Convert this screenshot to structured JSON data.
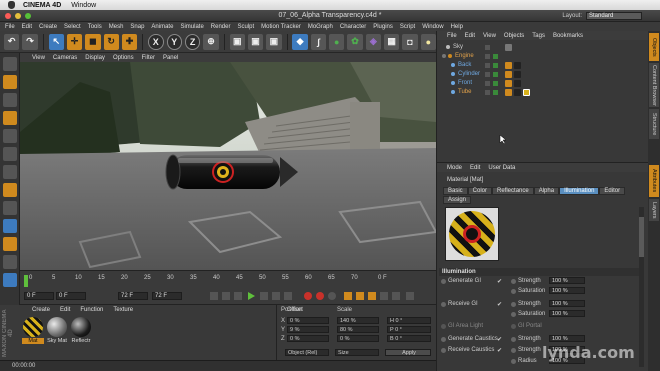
{
  "os_menu": {
    "app_name": "CINEMA 4D",
    "items": [
      "Window"
    ]
  },
  "window": {
    "title": "07_06_Alpha Transparency.c4d *",
    "layout_label": "Layout:",
    "layout_value": "Standard"
  },
  "main_menu": [
    "File",
    "Edit",
    "Create",
    "Select",
    "Tools",
    "Mesh",
    "Snap",
    "Animate",
    "Simulate",
    "Render",
    "Sculpt",
    "Motion Tracker",
    "MoGraph",
    "Character",
    "Plugins",
    "Script",
    "Window",
    "Help"
  ],
  "toolbar": {
    "axis_x": "X",
    "axis_y": "Y",
    "axis_z": "Z"
  },
  "viewport_menu": [
    "View",
    "Cameras",
    "Display",
    "Options",
    "Filter",
    "Panel"
  ],
  "timeline": {
    "ticks": [
      "0",
      "5",
      "10",
      "15",
      "20",
      "25",
      "30",
      "35",
      "40",
      "45",
      "50",
      "55",
      "60",
      "65",
      "70",
      "0 F"
    ],
    "start_field": "0 F",
    "current_field": "0 F",
    "end_field": "72 F",
    "max_field": "72 F"
  },
  "material_manager": {
    "menu": [
      "Create",
      "Edit",
      "Function",
      "Texture"
    ],
    "materials": [
      {
        "name": "Mat",
        "selected": true
      },
      {
        "name": "Sky Mat",
        "selected": false
      },
      {
        "name": "Reflectr",
        "selected": false
      }
    ]
  },
  "coordinates": {
    "headers": {
      "position": "Position",
      "offset": "Offset",
      "scale": "Scale"
    },
    "rows": [
      {
        "axis": "X",
        "pos": "0 %",
        "scale": "140 %",
        "extra": "H  0 °"
      },
      {
        "axis": "Y",
        "pos": "9 %",
        "scale": "80 %",
        "extra": "P  0 °"
      },
      {
        "axis": "Z",
        "pos": "0 %",
        "scale": "0 %",
        "extra": "B  0 °"
      }
    ],
    "mode_select": "Object (Rel)",
    "size_select": "Size",
    "apply_label": "Apply"
  },
  "status_text": "00:00:00",
  "maxon_text": "MAXON CINEMA 4D",
  "object_manager": {
    "menu": [
      "File",
      "Edit",
      "View",
      "Objects",
      "Tags",
      "Bookmarks"
    ],
    "objects": [
      {
        "name": "Sky",
        "indent": 0,
        "color": "#bbbbbb"
      },
      {
        "name": "Engine",
        "indent": 0,
        "color": "#d08a1e"
      },
      {
        "name": "Back",
        "indent": 1,
        "color": "#6fa8e0"
      },
      {
        "name": "Cylinder",
        "indent": 1,
        "color": "#6fa8e0"
      },
      {
        "name": "Front",
        "indent": 1,
        "color": "#6fa8e0"
      },
      {
        "name": "Tube",
        "indent": 1,
        "color": "#d08a1e"
      }
    ]
  },
  "attribute_manager": {
    "menu": [
      "Mode",
      "Edit",
      "User Data"
    ],
    "header": "Material [Mat]",
    "tabs": [
      "Basic",
      "Color",
      "Reflectance",
      "Alpha",
      "Illumination",
      "Editor"
    ],
    "active_tab": "Illumination",
    "assign_tab": "Assign",
    "section": "Illumination",
    "gi_rows": [
      {
        "label": "Generate GI",
        "checked": true,
        "strength": "100 %",
        "saturation": "100 %"
      },
      {
        "label": "Receive GI",
        "checked": true,
        "strength": "100 %",
        "saturation": "100 %"
      }
    ],
    "gi_area_light": "GI Area Light",
    "gi_portal": "GI Portal",
    "caustics": [
      {
        "label": "Generate Caustics",
        "checked": true,
        "prop": "Strength",
        "value": "100 %"
      },
      {
        "label": "Receive Caustics",
        "checked": true,
        "prop": "Strength",
        "value": "100 %"
      }
    ],
    "radius_label": "Radius",
    "radius_value": "100 %",
    "strength_label": "Strength",
    "saturation_label": "Saturation"
  },
  "right_tabs": [
    "Objects",
    "Content Browser",
    "Structure",
    "Attributes",
    "Layers"
  ],
  "watermark": "lynda.com"
}
